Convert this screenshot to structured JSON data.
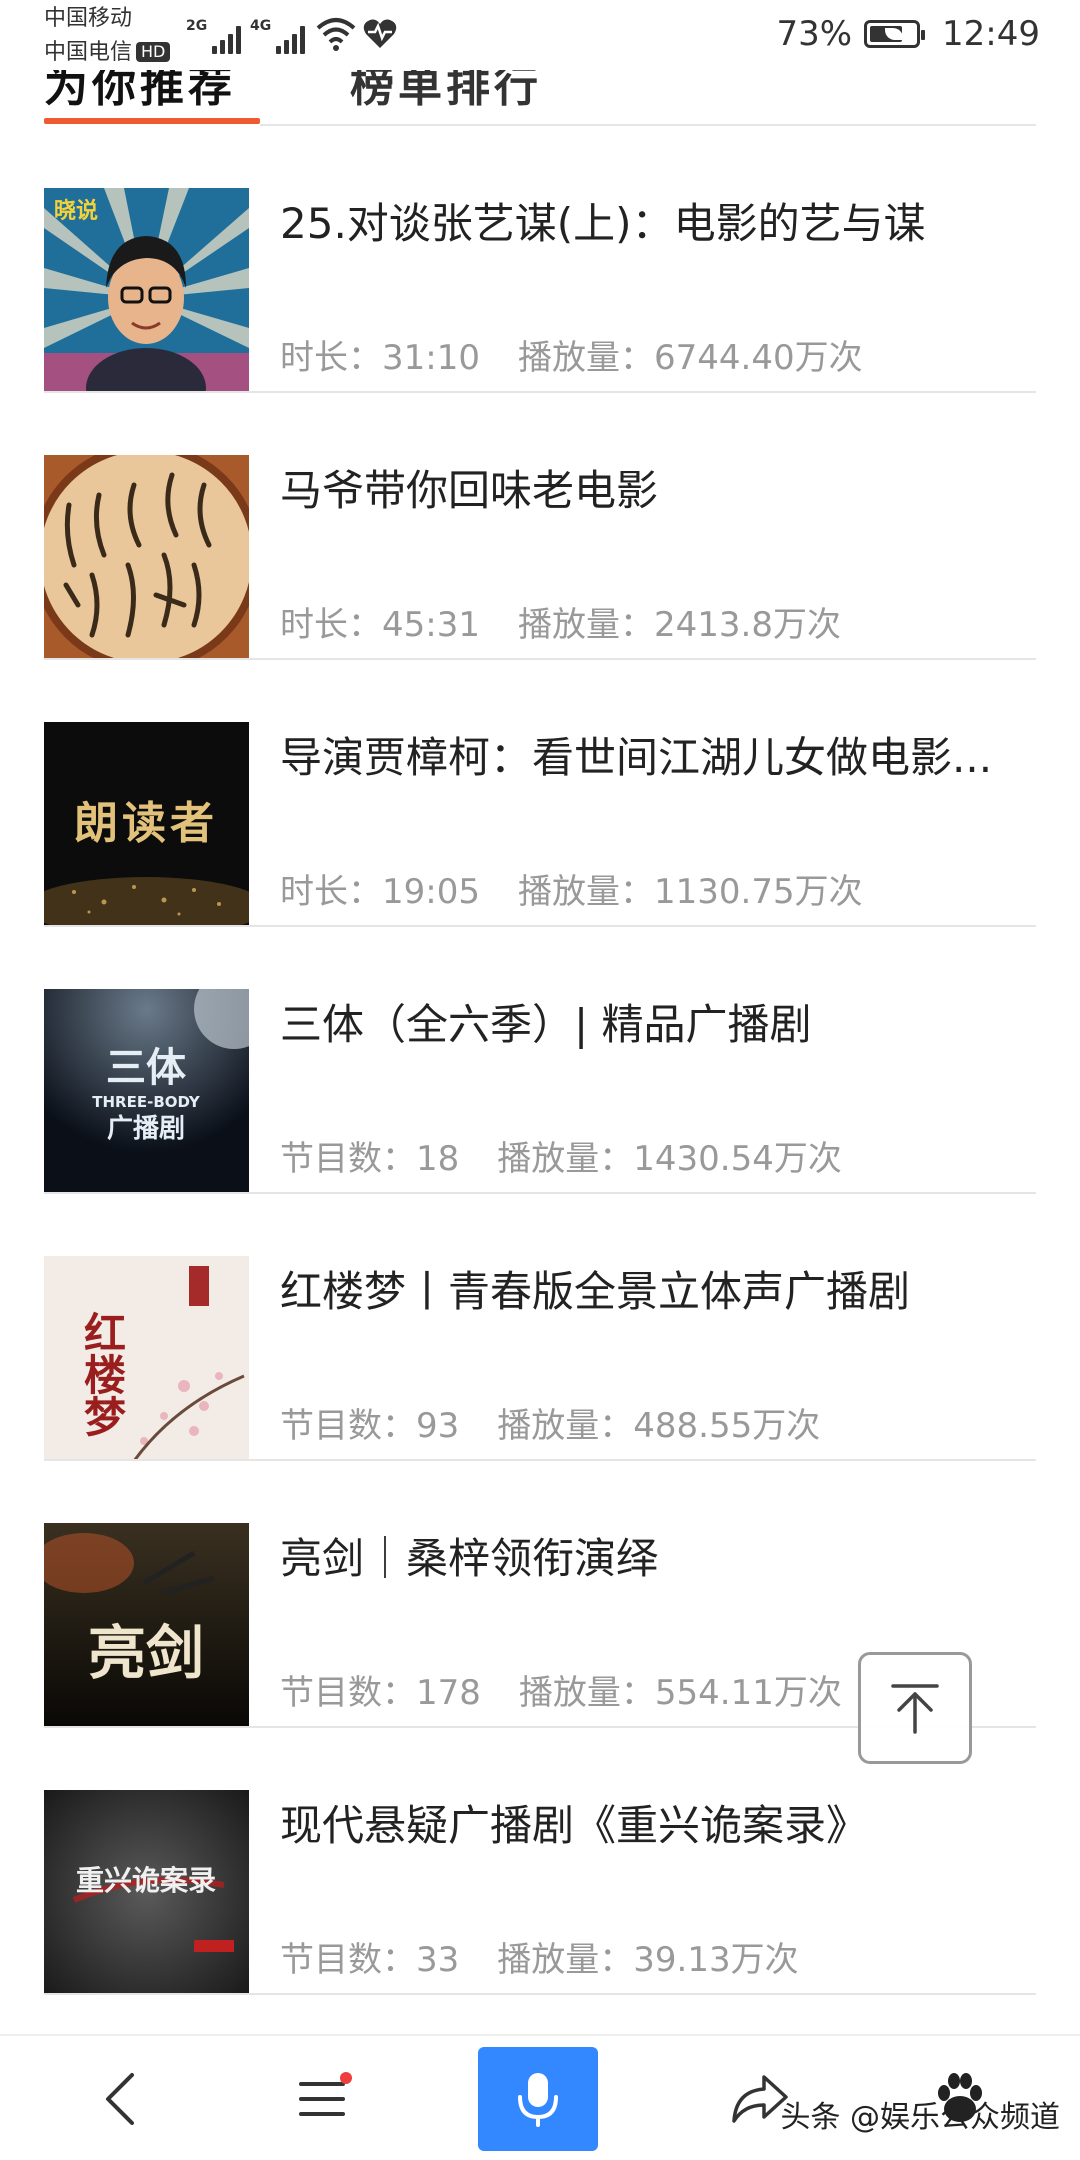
{
  "status_bar": {
    "carrier_1": "中国移动",
    "carrier_2": "中国电信",
    "hd_label": "HD",
    "signal_1_label": "2G",
    "signal_2_label": "4G",
    "battery_percent": "73%",
    "battery_level": 0.73,
    "time": "12:49"
  },
  "tabs": [
    {
      "label": "为你推荐",
      "active": true
    },
    {
      "label": "榜单排行",
      "active": false
    }
  ],
  "items": [
    {
      "title": "25.对谈张艺谋(上)：电影的艺与谋",
      "meta_1_label": "时长：",
      "meta_1_value": "31:10",
      "meta_2_label": "播放量：",
      "meta_2_value": "6744.40万次",
      "thumb_icon": "portrait-cover",
      "thumb_text": "晓说"
    },
    {
      "title": "马爷带你回味老电影",
      "meta_1_label": "时长：",
      "meta_1_value": "45:31",
      "meta_2_label": "播放量：",
      "meta_2_value": "2413.8万次",
      "thumb_icon": "calligraphy-cover",
      "thumb_text": ""
    },
    {
      "title": "导演贾樟柯：看世间江湖儿女做电影...",
      "meta_1_label": "时长：",
      "meta_1_value": "19:05",
      "meta_2_label": "播放量：",
      "meta_2_value": "1130.75万次",
      "thumb_icon": "dark-gold-cover",
      "thumb_text": "朗读者"
    },
    {
      "title": "三体（全六季）| 精品广播剧",
      "meta_1_label": "节目数：",
      "meta_1_value": "18",
      "meta_2_label": "播放量：",
      "meta_2_value": "1430.54万次",
      "thumb_icon": "space-cover",
      "thumb_text": "三体",
      "thumb_sub": "THREE-BODY",
      "thumb_sub2": "广播剧"
    },
    {
      "title": "红楼梦丨青春版全景立体声广播剧",
      "meta_1_label": "节目数：",
      "meta_1_value": "93",
      "meta_2_label": "播放量：",
      "meta_2_value": "488.55万次",
      "thumb_icon": "blossom-cover",
      "thumb_text": "红楼梦"
    },
    {
      "title": "亮剑｜桑梓领衔演绎",
      "meta_1_label": "节目数：",
      "meta_1_value": "178",
      "meta_2_label": "播放量：",
      "meta_2_value": "554.11万次",
      "thumb_icon": "war-cover",
      "thumb_text": "亮剑"
    },
    {
      "title": "现代悬疑广播剧《重兴诡案录》",
      "meta_1_label": "节目数：",
      "meta_1_value": "33",
      "meta_2_label": "播放量：",
      "meta_2_value": "39.13万次",
      "thumb_icon": "mystery-cover",
      "thumb_text": "重兴诡案录"
    }
  ],
  "bottom_nav": {
    "back_icon": "chevron-left-icon",
    "menu_icon": "hamburger-menu-icon",
    "mic_icon": "microphone-icon",
    "share_icon": "share-icon",
    "paw_icon": "baidu-paw-icon"
  },
  "watermark": "头条 @娱乐公众频道",
  "colors": {
    "accent": "#ef5a32",
    "mic_button": "#3388ff",
    "meta_text": "#999999",
    "divider": "#e5e5e5"
  }
}
